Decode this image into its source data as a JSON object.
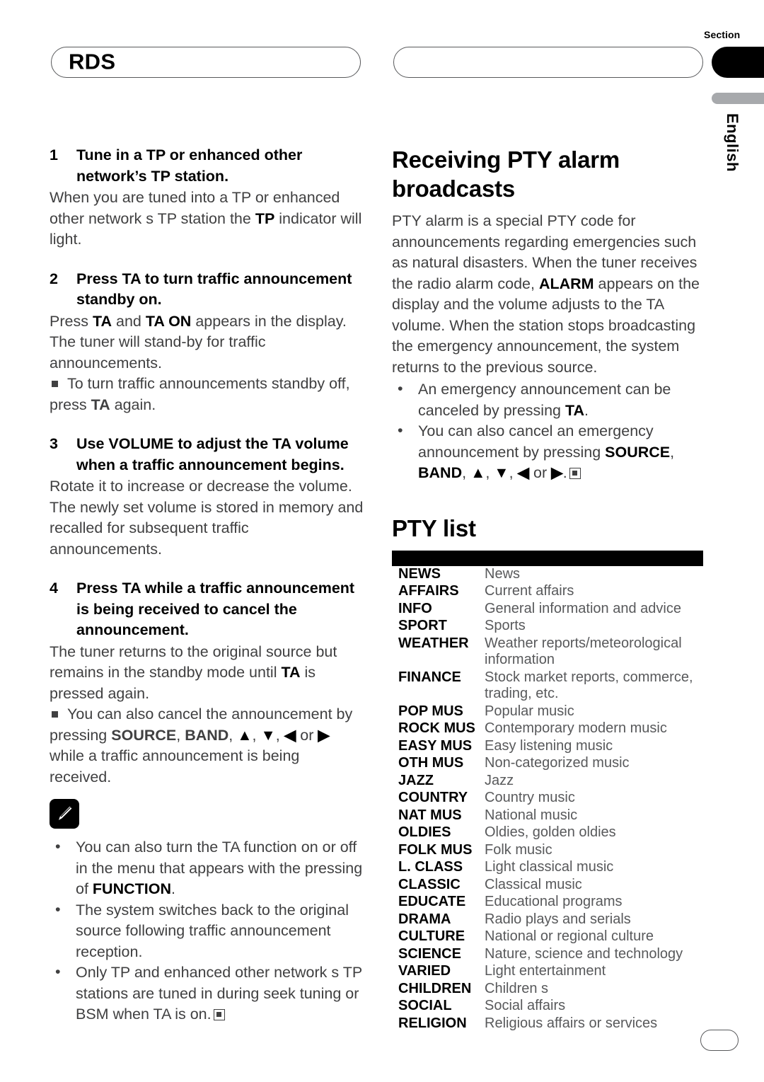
{
  "page": {
    "section_label": "Section",
    "language_label": "English",
    "left_header_title": "RDS",
    "right_header_title": "",
    "page_number": ""
  },
  "left_column": {
    "steps": [
      {
        "number": "1",
        "title": "Tune in a TP or enhanced other network’s TP station.",
        "body_html": "When you are tuned into a TP or enhanced other network s TP station the <b>TP</b> indicator will light."
      },
      {
        "number": "2",
        "title": "Press TA to turn traffic announcement standby on.",
        "body_html": "Press <b>TA</b> and <b>TA ON</b> appears in the display. The tuner will stand-by for traffic announcements.",
        "note_html": "To turn traffic announcements standby off, press <b>TA</b> again."
      },
      {
        "number": "3",
        "title": "Use VOLUME to adjust the TA volume when a traffic announcement begins.",
        "body_html": "Rotate it to increase or decrease the volume. The newly set volume is stored in memory and recalled for subsequent traffic announcements."
      },
      {
        "number": "4",
        "title": "Press TA while a traffic announcement is being received to cancel the announcement.",
        "body_html": "The tuner returns to the original source but remains in the standby mode until <b>TA</b> is pressed again.",
        "note_html": "You can also cancel the announcement by pressing <b>SOURCE</b>, <b>BAND</b>, <span class=\"arrowglyphs\">▲</span>, <span class=\"arrowglyphs\">▼</span>, <span class=\"arrowglyphs\">◀</span> or <span class=\"arrowglyphs\">▶</span> while a traffic announcement is being received."
      }
    ],
    "note_icon": "pencil-note-icon",
    "notes": [
      "You can also turn the TA function on or off in the menu that appears with the pressing of <b>FUNCTION</b>.",
      "The system switches back to the original source following traffic announcement reception.",
      "Only TP and enhanced other network s TP stations are tuned in during seek tuning or BSM when TA is on.<span class=\"endmark\"></span>"
    ]
  },
  "right_column": {
    "heading": "Receiving PTY alarm broadcasts",
    "intro_html": "PTY alarm is a special PTY code for announcements regarding emergencies such as natural disasters. When the tuner receives the radio alarm code, <b>ALARM</b> appears on the display and the volume adjusts to the TA volume. When the station stops broadcasting the emergency announcement, the system returns to the previous source.",
    "bullets": [
      "An emergency announcement can be canceled by pressing <b>TA</b>.",
      "You can also cancel an emergency announcement by pressing <b>SOURCE</b>, <b>BAND</b>, <span class=\"arrowglyphs\">▲</span>, <span class=\"arrowglyphs\">▼</span>, <span class=\"arrowglyphs\">◀</span> or <span class=\"arrowglyphs\">▶</span>.<span class=\"endmark\"></span>"
    ],
    "pty_list_heading": "PTY list",
    "pty_table": {
      "header": [
        "",
        ""
      ],
      "rows": [
        [
          "NEWS",
          "News"
        ],
        [
          "AFFAIRS",
          "Current affairs"
        ],
        [
          "INFO",
          "General information and advice"
        ],
        [
          "SPORT",
          "Sports"
        ],
        [
          "WEATHER",
          "Weather reports/meteorological information"
        ],
        [
          "FINANCE",
          "Stock market reports, commerce, trading, etc."
        ],
        [
          "POP MUS",
          "Popular music"
        ],
        [
          "ROCK MUS",
          "Contemporary modern music"
        ],
        [
          "EASY MUS",
          "Easy listening music"
        ],
        [
          "OTH MUS",
          "Non-categorized music"
        ],
        [
          "JAZZ",
          "Jazz"
        ],
        [
          "COUNTRY",
          "Country music"
        ],
        [
          "NAT MUS",
          "National music"
        ],
        [
          "OLDIES",
          "Oldies, golden oldies"
        ],
        [
          "FOLK MUS",
          "Folk music"
        ],
        [
          "L. CLASS",
          "Light classical music"
        ],
        [
          "CLASSIC",
          "Classical music"
        ],
        [
          "EDUCATE",
          "Educational programs"
        ],
        [
          "DRAMA",
          "Radio plays and serials"
        ],
        [
          "CULTURE",
          "National or regional culture"
        ],
        [
          "SCIENCE",
          "Nature, science and technology"
        ],
        [
          "VARIED",
          "Light entertainment"
        ],
        [
          "CHILDREN",
          "Children s"
        ],
        [
          "SOCIAL",
          "Social affairs"
        ],
        [
          "RELIGION",
          "Religious affairs or services"
        ]
      ]
    }
  },
  "colors": {
    "text": "#404041",
    "heading": "#000000",
    "rule": "#58595b",
    "tab": "#000000",
    "lang_bar": "#a7a9ac"
  }
}
